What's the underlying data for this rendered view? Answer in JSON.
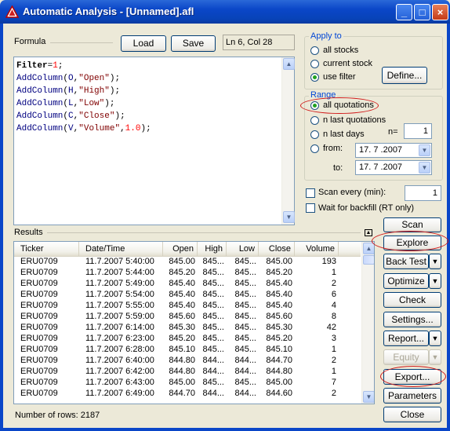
{
  "window": {
    "title": "Automatic Analysis - [Unnamed].afl",
    "controls": [
      "_",
      "□",
      "×"
    ]
  },
  "formula": {
    "label": "Formula",
    "load_label": "Load",
    "save_label": "Save",
    "cursor_pos": "Ln 6, Col 28"
  },
  "apply_to": {
    "label": "Apply to",
    "options": [
      "all stocks",
      "current stock",
      "use filter"
    ],
    "selected": "use filter",
    "define_label": "Define..."
  },
  "range": {
    "label": "Range",
    "options": [
      "all quotations",
      "n last quotations",
      "n last days",
      "from:"
    ],
    "selected": "all quotations",
    "n_label": "n=",
    "n_value": "1",
    "from_date": "17. 7 .2007",
    "to_label": "to:",
    "to_date": "17. 7 .2007"
  },
  "scan_every": {
    "label": "Scan every (min):",
    "value": "1",
    "checked": false
  },
  "wait_backfill": {
    "label": "Wait for backfill (RT only)",
    "checked": false
  },
  "results": {
    "label": "Results",
    "columns": [
      "Ticker",
      "Date/Time",
      "Open",
      "High",
      "Low",
      "Close",
      "Volume"
    ],
    "rows": [
      [
        "ERU0709",
        "11.7.2007 5:40:00",
        "845.00",
        "845...",
        "845...",
        "845.00",
        "193"
      ],
      [
        "ERU0709",
        "11.7.2007 5:44:00",
        "845.20",
        "845...",
        "845...",
        "845.20",
        "1"
      ],
      [
        "ERU0709",
        "11.7.2007 5:49:00",
        "845.40",
        "845...",
        "845...",
        "845.40",
        "2"
      ],
      [
        "ERU0709",
        "11.7.2007 5:54:00",
        "845.40",
        "845...",
        "845...",
        "845.40",
        "6"
      ],
      [
        "ERU0709",
        "11.7.2007 5:55:00",
        "845.40",
        "845...",
        "845...",
        "845.40",
        "4"
      ],
      [
        "ERU0709",
        "11.7.2007 5:59:00",
        "845.60",
        "845...",
        "845...",
        "845.60",
        "8"
      ],
      [
        "ERU0709",
        "11.7.2007 6:14:00",
        "845.30",
        "845...",
        "845...",
        "845.30",
        "42"
      ],
      [
        "ERU0709",
        "11.7.2007 6:23:00",
        "845.20",
        "845...",
        "845...",
        "845.20",
        "3"
      ],
      [
        "ERU0709",
        "11.7.2007 6:28:00",
        "845.10",
        "845...",
        "845...",
        "845.10",
        "1"
      ],
      [
        "ERU0709",
        "11.7.2007 6:40:00",
        "844.80",
        "844...",
        "844...",
        "844.70",
        "2"
      ],
      [
        "ERU0709",
        "11.7.2007 6:42:00",
        "844.80",
        "844...",
        "844...",
        "844.80",
        "1"
      ],
      [
        "ERU0709",
        "11.7.2007 6:43:00",
        "845.00",
        "845...",
        "845...",
        "845.00",
        "7"
      ],
      [
        "ERU0709",
        "11.7.2007 6:49:00",
        "844.70",
        "844...",
        "844...",
        "844.60",
        "2"
      ]
    ],
    "row_count": "Number of rows: 2187"
  },
  "buttons": {
    "scan": "Scan",
    "explore": "Explore",
    "back_test": "Back Test",
    "optimize": "Optimize",
    "check": "Check",
    "settings": "Settings...",
    "report": "Report...",
    "equity": "Equity",
    "export": "Export...",
    "parameters": "Parameters",
    "close": "Close"
  },
  "colors": {
    "title_bar": "#0a46c8",
    "group_label": "#0046d5",
    "highlight_ellipse": "#d01818"
  }
}
